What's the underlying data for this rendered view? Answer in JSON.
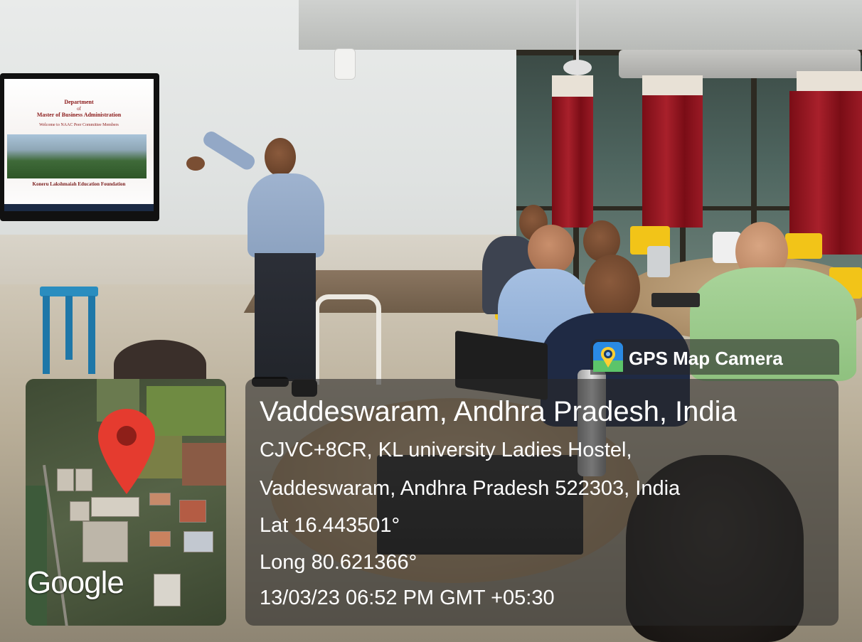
{
  "tv_slide": {
    "dept_line1": "Department",
    "dept_line2": "of",
    "dept_line3": "Master of Business Administration",
    "welcome": "Welcome to NAAC Peer Committee Members",
    "foundation": "Koneru Lakshmaiah Education Foundation"
  },
  "stamp": {
    "brand": "GPS Map Camera",
    "map_logo": "Google",
    "location_title": "Vaddeswaram, Andhra Pradesh, India",
    "address_line1": "CJVC+8CR, KL university Ladies Hostel,",
    "address_line2": "Vaddeswaram, Andhra Pradesh 522303, India",
    "latitude": "Lat 16.443501°",
    "longitude": "Long 80.621366°",
    "datetime": "13/03/23 06:52 PM GMT +05:30"
  },
  "colors": {
    "pin": "#e53b2f",
    "overlay": "rgba(40,40,40,0.58)",
    "curtain": "#a8202b"
  }
}
